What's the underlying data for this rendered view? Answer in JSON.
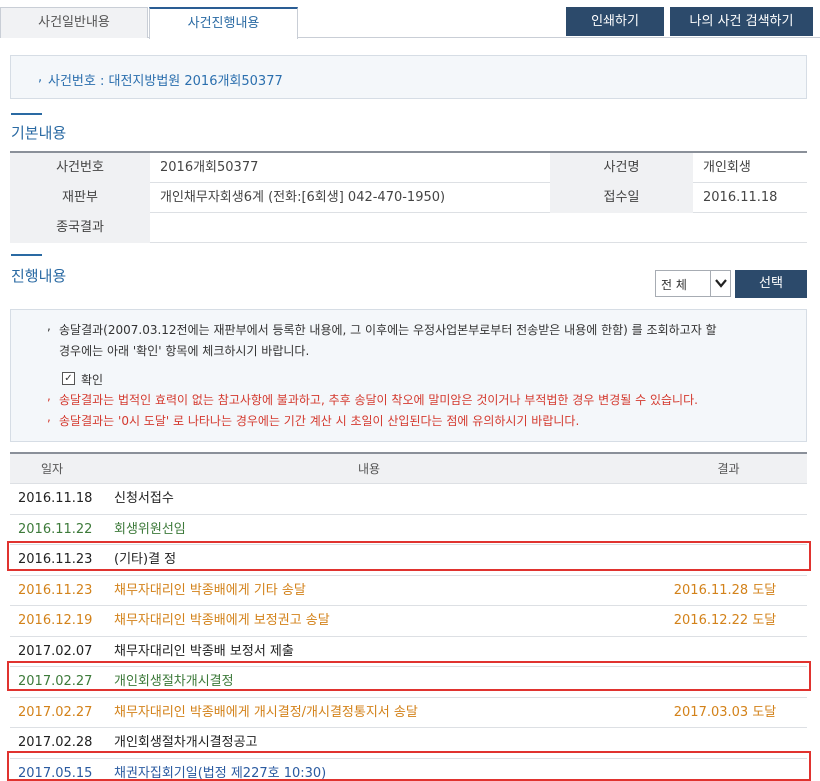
{
  "tabs": [
    {
      "label": "사건일반내용"
    },
    {
      "label": "사건진행내용"
    }
  ],
  "actions": {
    "print": "인쇄하기",
    "my_search": "나의 사건 검색하기"
  },
  "case_banner": "사건번호 : 대전지방법원 2016개회50377",
  "basic": {
    "title": "기본내용",
    "rows": [
      {
        "h1": "사건번호",
        "v1": "2016개회50377",
        "h2": "사건명",
        "v2": "개인회생"
      },
      {
        "h1": "재판부",
        "v1": "개인채무자회생6계 (전화:[6회생] 042-470-1950)",
        "h2": "접수일",
        "v2": "2016.11.18"
      },
      {
        "h1": "종국결과",
        "v1": "",
        "h2": "",
        "v2": ""
      }
    ]
  },
  "progress": {
    "title": "진행내용",
    "filter_value": "전 체",
    "select_button": "선택",
    "notice": {
      "line1": "송달결과(2007.03.12전에는 재판부에서 등록한 내용에, 그 이후에는 우정사업본부로부터 전송받은 내용에 한함) 를 조회하고자 할",
      "line2": "경우에는 아래 '확인' 항목에 체크하시기 바랍니다.",
      "check_label": "확인",
      "warn1": "송달결과는 법적인 효력이 없는 참고사항에 불과하고, 추후 송달이 착오에 말미암은 것이거나 부적법한 경우 변경될 수 있습니다.",
      "warn2": "송달결과는 '0시 도달' 로 나타나는 경우에는 기간 계산 시 초일이 산입된다는 점에 유의하시기 바랍니다."
    },
    "columns": {
      "date": "일자",
      "content": "내용",
      "result": "결과"
    },
    "rows": [
      {
        "date": "2016.11.18",
        "content": "신청서접수",
        "result": "",
        "color": "#222222"
      },
      {
        "date": "2016.11.22",
        "content": "회생위원선임",
        "result": "",
        "color": "#3d7a3a"
      },
      {
        "date": "2016.11.23",
        "content": "(기타)결 정",
        "result": "",
        "color": "#222222"
      },
      {
        "date": "2016.11.23",
        "content": "채무자대리인 박종배에게 기타 송달",
        "result": "2016.11.28 도달",
        "color": "#d3821a"
      },
      {
        "date": "2016.12.19",
        "content": "채무자대리인 박종배에게 보정권고 송달",
        "result": "2016.12.22 도달",
        "color": "#d3821a"
      },
      {
        "date": "2017.02.07",
        "content": "채무자대리인 박종배 보정서 제출",
        "result": "",
        "color": "#222222"
      },
      {
        "date": "2017.02.27",
        "content": "개인회생절차개시결정",
        "result": "",
        "color": "#3d7a3a"
      },
      {
        "date": "2017.02.27",
        "content": "채무자대리인 박종배에게 개시결정/개시결정통지서 송달",
        "result": "2017.03.03 도달",
        "color": "#d3821a"
      },
      {
        "date": "2017.02.28",
        "content": "개인회생절차개시결정공고",
        "result": "",
        "color": "#222222"
      },
      {
        "date": "2017.05.15",
        "content": "채권자집회기일(법정 제227호 10:30)",
        "result": "",
        "color": "#2a5aa0"
      }
    ]
  }
}
